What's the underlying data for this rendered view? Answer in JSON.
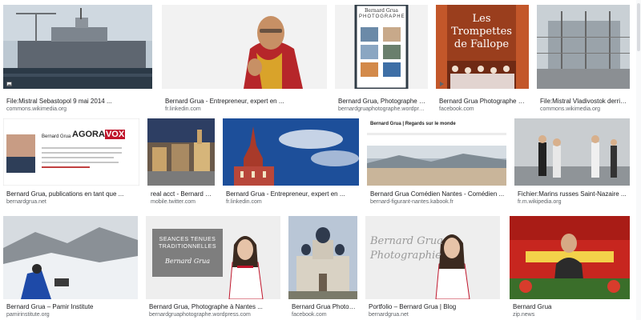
{
  "results": [
    {
      "caption": "File:Mistral Sebastopol 9 mai 2014 ...",
      "source": "commons.wikimedia.org",
      "icon": "image-icon"
    },
    {
      "caption": "Bernard Grua - Entrepreneur, expert en ...",
      "source": "fr.linkedin.com"
    },
    {
      "caption": "Bernard Grua, Photographe à Nante...",
      "source": "bernardgruaphotographe.wordpress...",
      "thumb_text": [
        "Bernard Grua",
        "PHOTOGRAPHE"
      ]
    },
    {
      "caption": "Bernard Grua Photographe à Nante...",
      "source": "facebook.com",
      "icon": "play-icon",
      "thumb_text": [
        "Les",
        "Trompettes",
        "de Fallope"
      ]
    },
    {
      "caption": "File:Mistral Vladivostok derrière ...",
      "source": "commons.wikimedia.org"
    },
    {
      "caption": "Bernard Grua, publications en tant que ...",
      "source": "bernardgrua.net",
      "thumb_text": [
        "Bernard Grua",
        "AGORA",
        "VOX"
      ]
    },
    {
      "caption": "real acct - Bernard Gr...",
      "source": "mobile.twitter.com"
    },
    {
      "caption": "Bernard Grua - Entrepreneur, expert en ...",
      "source": "fr.linkedin.com"
    },
    {
      "caption": "Bernard Grua Comédien Nantes - Comédien ...",
      "source": "bernard-figurant-nantes.kabook.fr",
      "thumb_text": [
        "Bernard Grua | Regards sur le monde"
      ]
    },
    {
      "caption": "Fichier:Marins russes Saint-Nazaire ...",
      "source": "fr.m.wikipedia.org"
    },
    {
      "caption": "Bernard Grua – Pamir Institute",
      "source": "pamirinstitute.org"
    },
    {
      "caption": "Bernard Grua, Photographe à Nantes ...",
      "source": "bernardgruaphotographe.wordpress.com",
      "thumb_text": [
        "SEANCES TENUES",
        "TRADITIONNELLES",
        "Bernard Grua"
      ]
    },
    {
      "caption": "Bernard Grua Photogra...",
      "source": "facebook.com"
    },
    {
      "caption": "Portfolio – Bernard Grua | Blog",
      "source": "bernardgrua.net",
      "thumb_text": [
        "Bernard Grua",
        "Photographie"
      ]
    },
    {
      "caption": "Bernard Grua",
      "source": "zip.news"
    }
  ],
  "colors": {
    "caption": "#202124",
    "source": "#5f6368",
    "accent": "#c0152b"
  }
}
